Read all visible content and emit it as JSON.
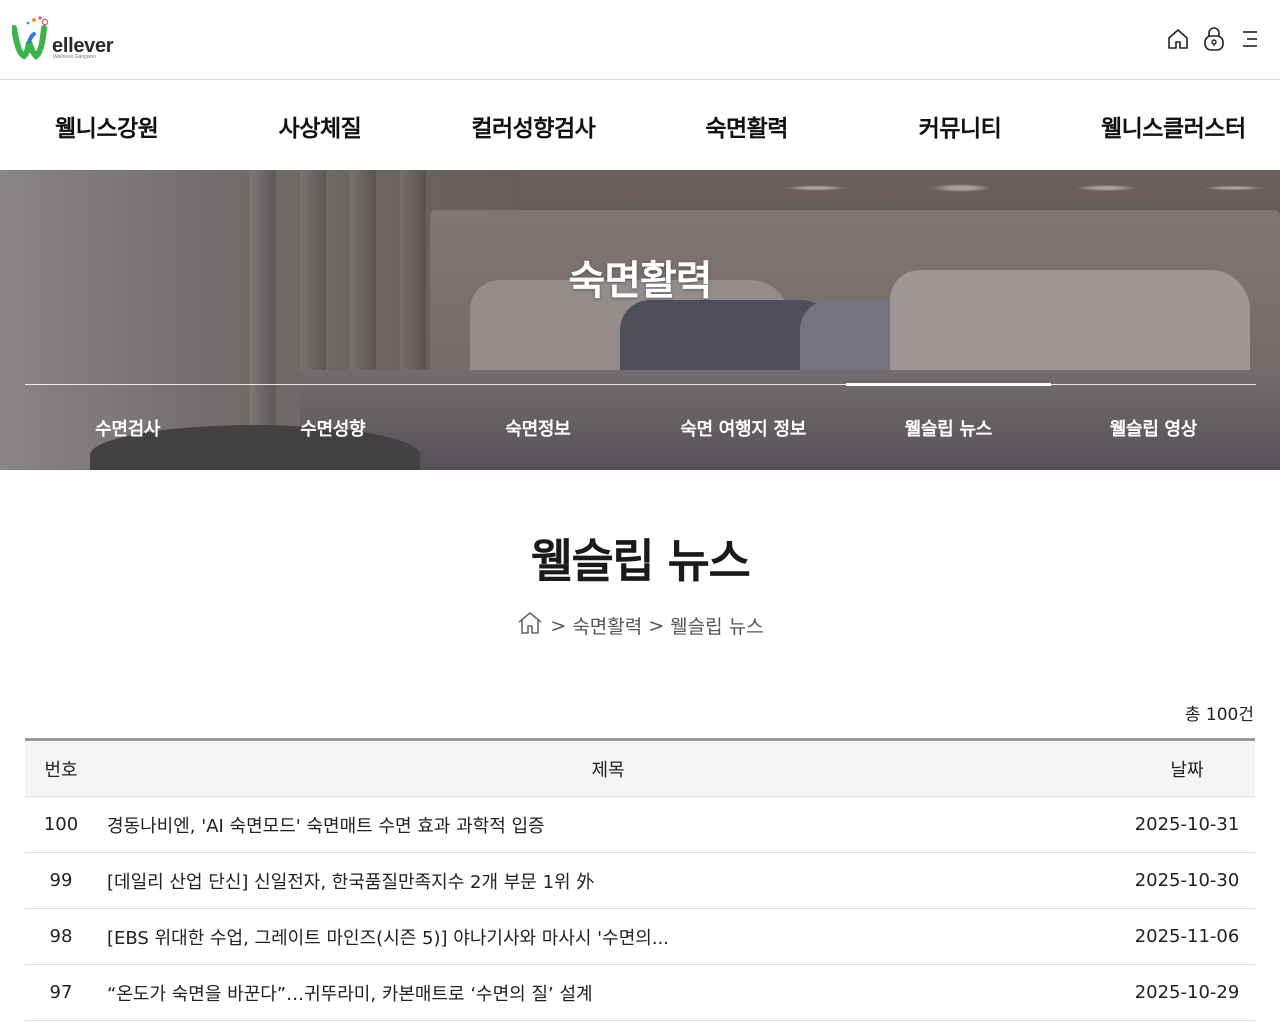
{
  "header": {
    "logo_text": "ellever",
    "logo_sub": "Wellness Gangwon",
    "icons": [
      "home-icon",
      "lock-icon",
      "menu-icon"
    ]
  },
  "gnb": {
    "items": [
      "웰니스강원",
      "사상체질",
      "컬러성향검사",
      "숙면활력",
      "커뮤니티",
      "웰니스클러스터"
    ]
  },
  "hero": {
    "title": "숙면활력",
    "tabs": [
      "수면검사",
      "수면성향",
      "숙면정보",
      "숙면 여행지 정보",
      "웰슬립 뉴스",
      "웰슬립 영상"
    ],
    "active_tab": "웰슬립 뉴스"
  },
  "page": {
    "title": "웰슬립 뉴스",
    "breadcrumb": [
      "숙면활력",
      "웰슬립 뉴스"
    ]
  },
  "board": {
    "total": "총 100건",
    "headers": {
      "no": "번호",
      "title": "제목",
      "date": "날짜"
    },
    "rows": [
      {
        "no": "100",
        "title": "경동나비엔, 'AI 숙면모드' 숙면매트 수면 효과 과학적 입증",
        "date": "2025-10-31"
      },
      {
        "no": "99",
        "title": "[데일리 산업 단신] 신일전자, 한국품질만족지수 2개 부문 1위 外",
        "date": "2025-10-30"
      },
      {
        "no": "98",
        "title": "[EBS 위대한 수업, 그레이트 마인즈(시즌 5)] 야나기사와 마사시 '수면의...",
        "date": "2025-11-06"
      },
      {
        "no": "97",
        "title": "“온도가 숙면을 바꾼다”…귀뚜라미, 카본매트로 ‘수면의 질’ 설계",
        "date": "2025-10-29"
      }
    ]
  },
  "colors": {
    "logo_green": "#3bb54a",
    "logo_blue": "#2f7fd1",
    "header_border": "#dcdcdc",
    "table_header_bg": "#f5f5f5",
    "table_top_border": "#999999"
  }
}
